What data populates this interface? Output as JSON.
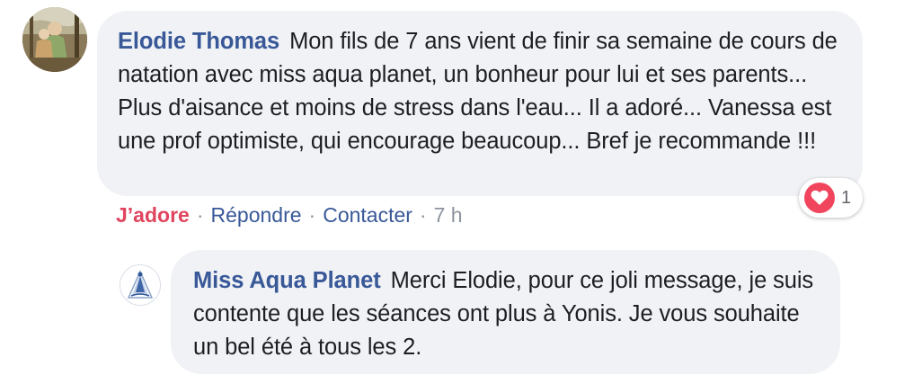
{
  "comment": {
    "author": "Elodie Thomas",
    "text": "Mon fils de 7 ans vient de finir sa semaine de cours de natation avec miss aqua planet, un bonheur pour lui et ses parents... Plus d'aisance et moins de stress dans l'eau... Il a adoré... Vanessa est une prof optimiste, qui encourage beaucoup... Bref je recommande !!!",
    "actions": {
      "reaction_label": "J’adore",
      "reply_label": "Répondre",
      "contact_label": "Contacter",
      "timestamp": "7 h",
      "separator": "·"
    },
    "reaction": {
      "icon": "heart-icon",
      "count": "1",
      "color": "#f0455d"
    }
  },
  "reply": {
    "author": "Miss Aqua Planet",
    "text": "Merci Elodie, pour ce joli message, je suis contente que les séances ont plus à Yonis. Je vous souhaite un bel été à tous les 2."
  },
  "colors": {
    "author": "#385898",
    "bubble": "#f0f2f5",
    "love": "#e0455e",
    "meta": "#8d949e"
  }
}
